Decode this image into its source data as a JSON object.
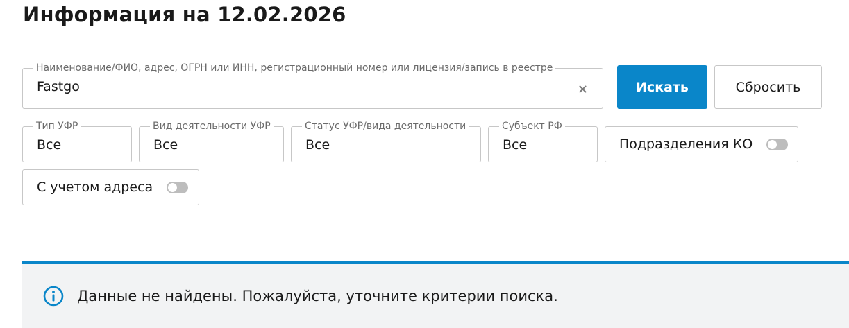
{
  "page": {
    "title": "Информация на 12.02.2026"
  },
  "search": {
    "label": "Наименование/ФИО, адрес, ОГРН или ИНН, регистрационный номер или лицензия/запись в реестре",
    "value": "Fastgo",
    "clear_icon": "close-icon"
  },
  "buttons": {
    "search_label": "Искать",
    "reset_label": "Сбросить"
  },
  "filters": {
    "type": {
      "label": "Тип УФР",
      "value": "Все"
    },
    "kind": {
      "label": "Вид деятельности УФР",
      "value": "Все"
    },
    "status": {
      "label": "Статус УФР/вида деятельности",
      "value": "Все"
    },
    "subject": {
      "label": "Субъект РФ",
      "value": "Все"
    }
  },
  "toggles": {
    "branches": {
      "label": "Подразделения КО",
      "on": false
    },
    "address": {
      "label": "С учетом адреса",
      "on": false
    }
  },
  "notice": {
    "icon": "info-icon",
    "text": "Данные не найдены. Пожалуйста, уточните критерии поиска."
  },
  "colors": {
    "accent": "#0a86c9",
    "notice_bg": "#f2f3f4",
    "border": "#c7c7c7",
    "toggle_off": "#bdbdbd"
  }
}
